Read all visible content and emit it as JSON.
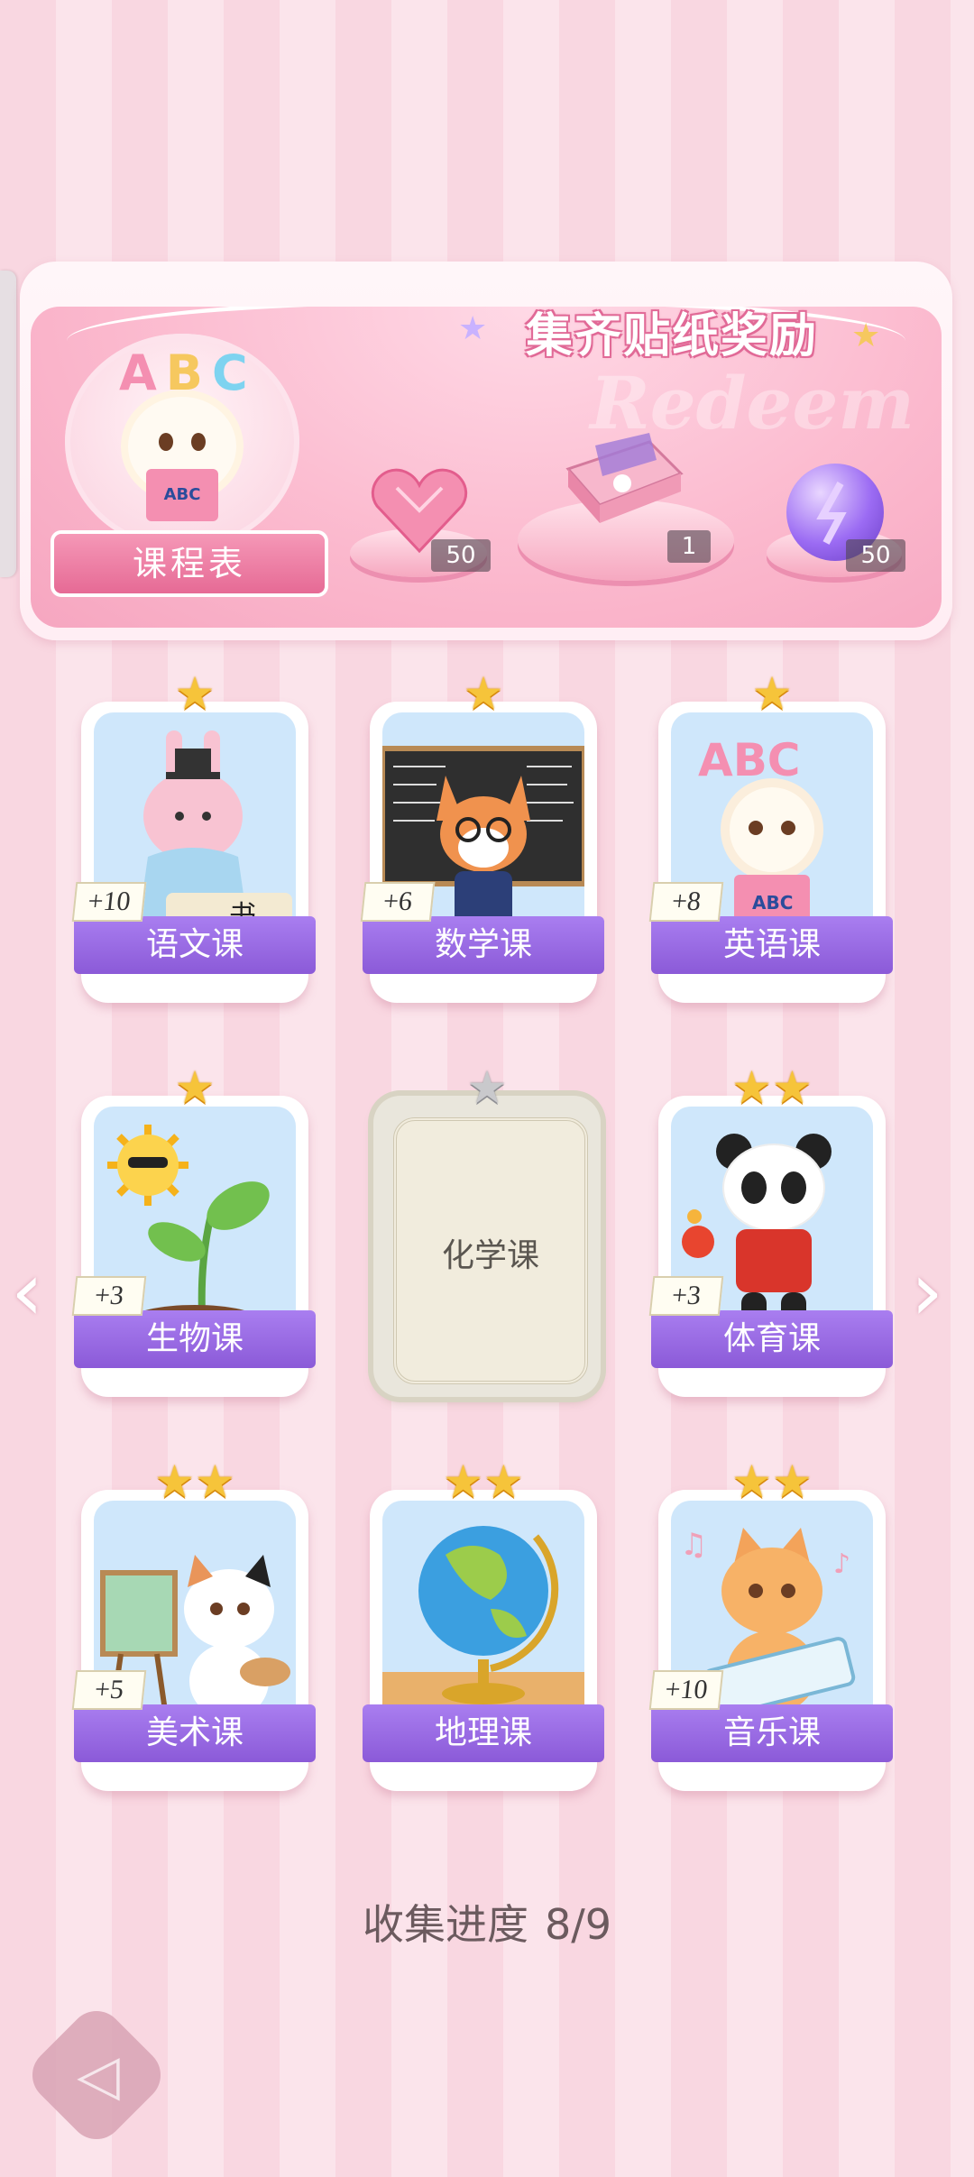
{
  "banner": {
    "title": "集齐贴纸奖励",
    "watermark": "Redeem",
    "schedule_label": "课程表",
    "avatar_letters": [
      "A",
      "B",
      "C"
    ],
    "avatar_book_text": "ABC",
    "rewards": [
      {
        "name": "pink-gem",
        "count": "50"
      },
      {
        "name": "gift-box",
        "count": "1"
      },
      {
        "name": "purple-orb",
        "count": "50"
      }
    ]
  },
  "cards": [
    {
      "label": "语文课",
      "badge": "+10",
      "stars": "★",
      "icon": "bunny-calligraphy"
    },
    {
      "label": "数学课",
      "badge": "+6",
      "stars": "★",
      "icon": "fox-teacher"
    },
    {
      "label": "英语课",
      "badge": "+8",
      "stars": "★",
      "icon": "puppy-abc",
      "art_letters": "ABC",
      "art_book": "ABC"
    },
    {
      "label": "生物课",
      "badge": "+3",
      "stars": "★",
      "icon": "sun-sprout"
    },
    {
      "label": "化学课",
      "badge": "",
      "stars": "★",
      "icon": "locked-card",
      "locked": true
    },
    {
      "label": "体育课",
      "badge": "+3",
      "stars": "★★",
      "icon": "panda-pingpong"
    },
    {
      "label": "美术课",
      "badge": "+5",
      "stars": "★★",
      "icon": "cat-painter"
    },
    {
      "label": "地理课",
      "badge": "",
      "stars": "★★",
      "icon": "globe"
    },
    {
      "label": "音乐课",
      "badge": "+10",
      "stars": "★★",
      "icon": "cat-keyboard"
    }
  ],
  "progress": {
    "label": "收集进度",
    "value": "8/9"
  },
  "nav": {
    "prev_icon": "‹",
    "next_icon": "›",
    "back_icon": "◁"
  }
}
